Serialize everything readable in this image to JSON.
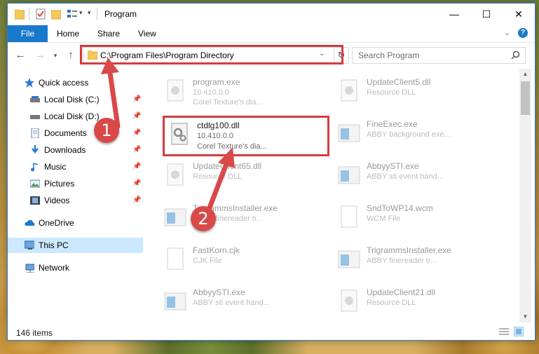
{
  "window": {
    "title": "Program",
    "minimize_icon": "minimize-icon",
    "maximize_icon": "maximize-icon",
    "close_icon": "close-icon"
  },
  "ribbon": {
    "file": "File",
    "home": "Home",
    "share": "Share",
    "view": "View"
  },
  "address": {
    "path": "C:\\Program Files\\Program Directory"
  },
  "search": {
    "placeholder": "Search Program"
  },
  "navpane": {
    "quick_access": "Quick access",
    "items": [
      {
        "label": "Local Disk (C:)",
        "icon": "drive-icon"
      },
      {
        "label": "Local Disk (D:)",
        "icon": "drive-icon"
      },
      {
        "label": "Documents",
        "icon": "documents-icon"
      },
      {
        "label": "Downloads",
        "icon": "downloads-icon"
      },
      {
        "label": "Music",
        "icon": "music-icon"
      },
      {
        "label": "Pictures",
        "icon": "pictures-icon"
      },
      {
        "label": "Videos",
        "icon": "videos-icon"
      }
    ],
    "onedrive": "OneDrive",
    "this_pc": "This PC",
    "network": "Network"
  },
  "files": {
    "left": [
      {
        "name": "program.exe",
        "line1": "10.410.0.0",
        "line2": "Corel Texture's dia..."
      },
      {
        "name": "ctdlg100.dll",
        "line1": "10.410.0.0",
        "line2": "Corel Texture's dia..."
      },
      {
        "name": "UpdateClient65.dll",
        "line1": "Resource DLL",
        "line2": ""
      },
      {
        "name": "TrigrammsInstaller.exe",
        "line1": "ABBY finereader tr...",
        "line2": ""
      },
      {
        "name": "FastKorn.cjk",
        "line1": "CJK File",
        "line2": ""
      },
      {
        "name": "AbbyySTI.exe",
        "line1": "ABBY sti event hand...",
        "line2": ""
      }
    ],
    "right": [
      {
        "name": "UpdateClient5.dll",
        "line1": "Resource DLL",
        "line2": ""
      },
      {
        "name": "FineExec.exe",
        "line1": "ABBY background exe...",
        "line2": ""
      },
      {
        "name": "AbbyySTI.exe",
        "line1": "ABBY sti event hand...",
        "line2": ""
      },
      {
        "name": "SndToWP14.wcm",
        "line1": "WCM File",
        "line2": ""
      },
      {
        "name": "TrigrammsInstaller.exe",
        "line1": "ABBY finereader tr...",
        "line2": ""
      },
      {
        "name": "UpdateClient21.dll",
        "line1": "Resource DLL",
        "line2": ""
      }
    ]
  },
  "status": {
    "item_count": "146 items"
  },
  "annotations": {
    "step1": "1",
    "step2": "2",
    "color": "#d9494a"
  }
}
